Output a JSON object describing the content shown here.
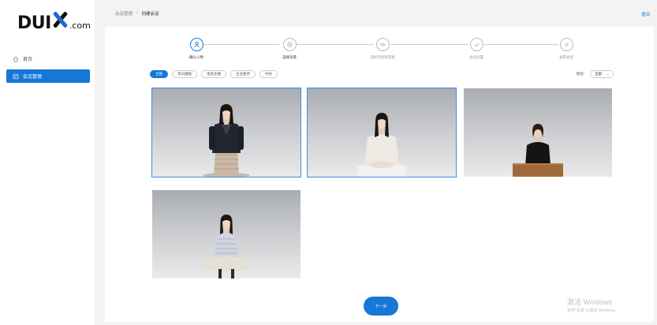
{
  "logo": {
    "part1": "DUI",
    "part2": ".com"
  },
  "sidebar": {
    "items": [
      {
        "label": "首页",
        "icon": "home-icon"
      },
      {
        "label": "会话管理",
        "icon": "chat-icon",
        "active": true
      }
    ]
  },
  "breadcrumb": {
    "parent": "会话管理",
    "separator": "/",
    "current": "创建会话"
  },
  "header": {
    "logout": "退出"
  },
  "steps": [
    {
      "label": "确认人物",
      "icon": "person-icon",
      "state": "active"
    },
    {
      "label": "选择背景",
      "icon": "background-icon",
      "state": "done"
    },
    {
      "label": "选择音色和回复",
      "icon": "voice-icon",
      "state": "pending"
    },
    {
      "label": "会话设置",
      "icon": "check-icon",
      "state": "pending"
    },
    {
      "label": "发布会话",
      "icon": "publish-icon",
      "state": "pending"
    }
  ],
  "filters": {
    "chips": [
      "全部",
      "资讯播报",
      "电商主播",
      "企业服务",
      "导办"
    ],
    "active_index": 0,
    "gender_label": "性别：",
    "gender_value": "全部"
  },
  "characters": [
    {
      "name": "standing-woman-dark-jacket",
      "selected": true
    },
    {
      "name": "seated-woman-white-blouse",
      "selected": true
    },
    {
      "name": "woman-at-wooden-desk",
      "selected": false
    },
    {
      "name": "seated-woman-striped-top",
      "selected": false
    }
  ],
  "next_button": "下一步",
  "watermark": {
    "title": "激活 Windows",
    "subtitle": "转到\"设置\"以激活 Windows。"
  },
  "colors": {
    "accent": "#1677d8",
    "background": "#f2f3f5",
    "panel": "#ffffff"
  }
}
